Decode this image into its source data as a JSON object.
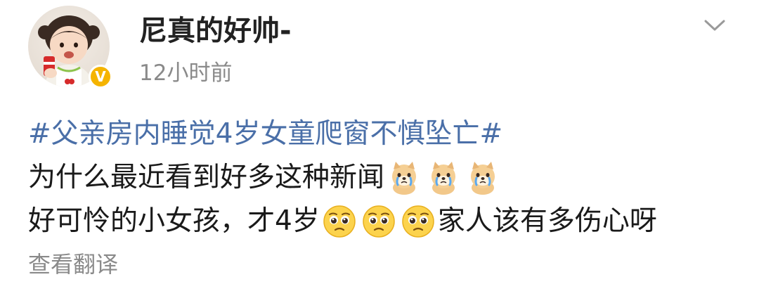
{
  "post": {
    "username": "尼真的好帅-",
    "timestamp": "12小时前",
    "verified_mark": "V",
    "hashtag": "#父亲房内睡觉4岁女童爬窗不慎坠亡#",
    "line1_text": "为什么最近看到好多这种新闻",
    "line2_text_before": "好可怜的小女孩，才4岁",
    "line2_text_after": "家人该有多伤心呀",
    "translate_label": "查看翻译"
  },
  "icons": {
    "menu": "chevron-down-icon",
    "dog_emoji": "crying-doge-emoji",
    "face_emoji": "pleading-face-emoji"
  },
  "colors": {
    "hashtag": "#4a6fa8",
    "secondary_text": "#8a8a8a",
    "verified": "#f5b400"
  }
}
